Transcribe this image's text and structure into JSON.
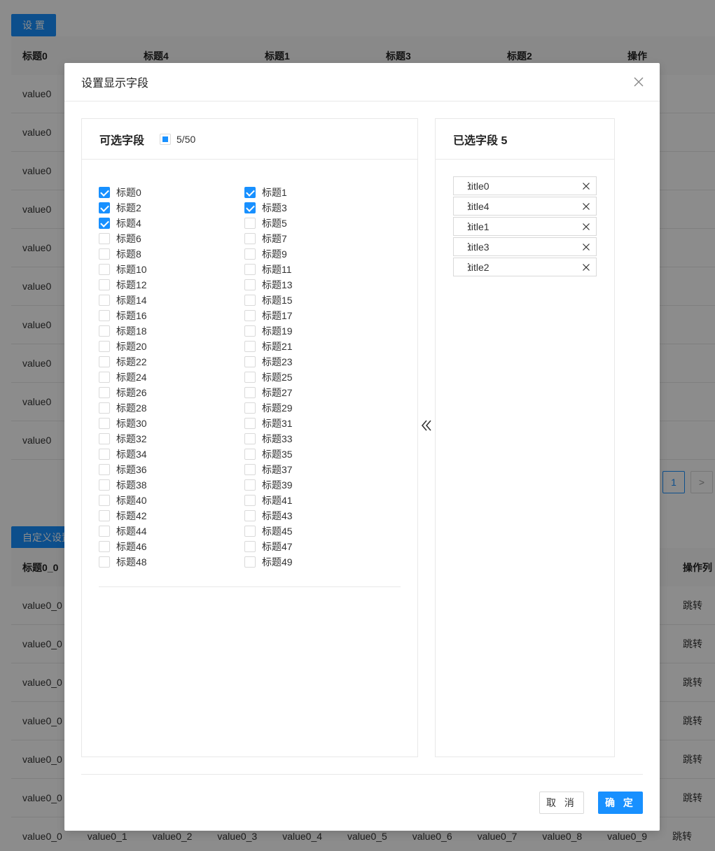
{
  "background": {
    "settings_button": "设 置",
    "table1": {
      "headers": [
        "标题0",
        "标题4",
        "标题1",
        "标题3",
        "标题2",
        "操作"
      ],
      "rows": [
        "value0",
        "value0",
        "value0",
        "value0",
        "value0",
        "value0",
        "value0",
        "value0",
        "value0",
        "value0"
      ]
    },
    "pager": {
      "current": "1",
      "next": ">"
    },
    "custom_button": "自定义设置",
    "table2": {
      "first_header": "标题0_0",
      "last_header": "操作列",
      "rows": [
        {
          "first": "value0_0",
          "action": "跳转"
        },
        {
          "first": "value0_0",
          "action": "跳转"
        },
        {
          "first": "value0_0",
          "action": "跳转"
        },
        {
          "first": "value0_0",
          "action": "跳转"
        },
        {
          "first": "value0_0",
          "action": "跳转"
        },
        {
          "first": "value0_0",
          "action": "跳转"
        }
      ],
      "last_row": [
        "value0_0",
        "value0_1",
        "value0_2",
        "value0_3",
        "value0_4",
        "value0_5",
        "value0_6",
        "value0_7",
        "value0_8",
        "value0_9",
        "跳转"
      ]
    }
  },
  "modal": {
    "title": "设置显示字段",
    "left_panel": {
      "title": "可选字段",
      "count": "5/50",
      "options": [
        {
          "label": "标题0",
          "checked": true
        },
        {
          "label": "标题1",
          "checked": true
        },
        {
          "label": "标题2",
          "checked": true
        },
        {
          "label": "标题3",
          "checked": true
        },
        {
          "label": "标题4",
          "checked": true
        },
        {
          "label": "标题5",
          "checked": false
        },
        {
          "label": "标题6",
          "checked": false
        },
        {
          "label": "标题7",
          "checked": false
        },
        {
          "label": "标题8",
          "checked": false
        },
        {
          "label": "标题9",
          "checked": false
        },
        {
          "label": "标题10",
          "checked": false
        },
        {
          "label": "标题11",
          "checked": false
        },
        {
          "label": "标题12",
          "checked": false
        },
        {
          "label": "标题13",
          "checked": false
        },
        {
          "label": "标题14",
          "checked": false
        },
        {
          "label": "标题15",
          "checked": false
        },
        {
          "label": "标题16",
          "checked": false
        },
        {
          "label": "标题17",
          "checked": false
        },
        {
          "label": "标题18",
          "checked": false
        },
        {
          "label": "标题19",
          "checked": false
        },
        {
          "label": "标题20",
          "checked": false
        },
        {
          "label": "标题21",
          "checked": false
        },
        {
          "label": "标题22",
          "checked": false
        },
        {
          "label": "标题23",
          "checked": false
        },
        {
          "label": "标题24",
          "checked": false
        },
        {
          "label": "标题25",
          "checked": false
        },
        {
          "label": "标题26",
          "checked": false
        },
        {
          "label": "标题27",
          "checked": false
        },
        {
          "label": "标题28",
          "checked": false
        },
        {
          "label": "标题29",
          "checked": false
        },
        {
          "label": "标题30",
          "checked": false
        },
        {
          "label": "标题31",
          "checked": false
        },
        {
          "label": "标题32",
          "checked": false
        },
        {
          "label": "标题33",
          "checked": false
        },
        {
          "label": "标题34",
          "checked": false
        },
        {
          "label": "标题35",
          "checked": false
        },
        {
          "label": "标题36",
          "checked": false
        },
        {
          "label": "标题37",
          "checked": false
        },
        {
          "label": "标题38",
          "checked": false
        },
        {
          "label": "标题39",
          "checked": false
        },
        {
          "label": "标题40",
          "checked": false
        },
        {
          "label": "标题41",
          "checked": false
        },
        {
          "label": "标题42",
          "checked": false
        },
        {
          "label": "标题43",
          "checked": false
        },
        {
          "label": "标题44",
          "checked": false
        },
        {
          "label": "标题45",
          "checked": false
        },
        {
          "label": "标题46",
          "checked": false
        },
        {
          "label": "标题47",
          "checked": false
        },
        {
          "label": "标题48",
          "checked": false
        },
        {
          "label": "标题49",
          "checked": false
        }
      ]
    },
    "right_panel": {
      "title": "已选字段 5",
      "handle": "⋮",
      "selected": [
        "title0",
        "title4",
        "title1",
        "title3",
        "title2"
      ]
    },
    "cancel_label": "取 消",
    "ok_label": "确 定",
    "colors": {
      "accent": "#1890ff",
      "mask": "rgba(0,0,0,0.45)"
    },
    "icons": {
      "close": "close-icon",
      "move_left": "double-chevron-left-icon",
      "remove": "close-icon",
      "drag": "drag-handle-icon"
    }
  }
}
